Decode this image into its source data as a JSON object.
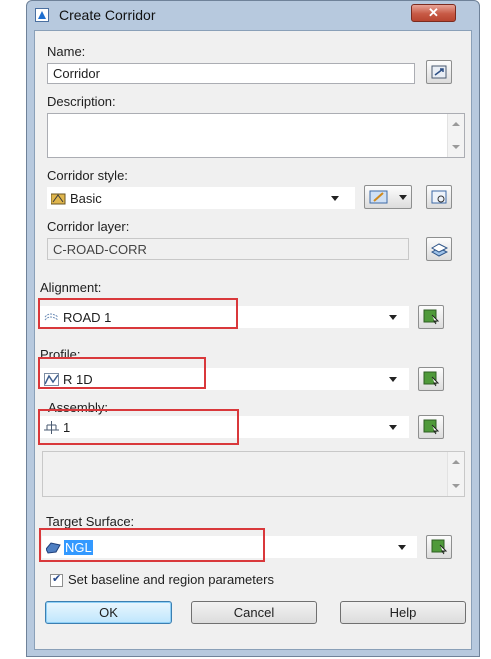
{
  "window": {
    "title": "Create Corridor",
    "close": "✕"
  },
  "name": {
    "label": "Name:",
    "value": "Corridor"
  },
  "description": {
    "label": "Description:",
    "value": ""
  },
  "corridor_style": {
    "label": "Corridor style:",
    "value": "Basic"
  },
  "corridor_layer": {
    "label": "Corridor layer:",
    "value": "C-ROAD-CORR"
  },
  "alignment": {
    "label": "Alignment:",
    "value": "ROAD 1"
  },
  "profile": {
    "label": "Profile:",
    "value": "R 1D"
  },
  "assembly": {
    "label": "Assembly:",
    "value": "1"
  },
  "target_surface": {
    "label": "Target Surface:",
    "value": "NGL"
  },
  "set_baseline": {
    "label": "Set baseline and region parameters",
    "checked": true
  },
  "buttons": {
    "ok": "OK",
    "cancel": "Cancel",
    "help": "Help"
  },
  "colors": {
    "highlight_box": "#d9383b",
    "selection": "#3399ff",
    "picker_green": "#4f9a3a"
  }
}
